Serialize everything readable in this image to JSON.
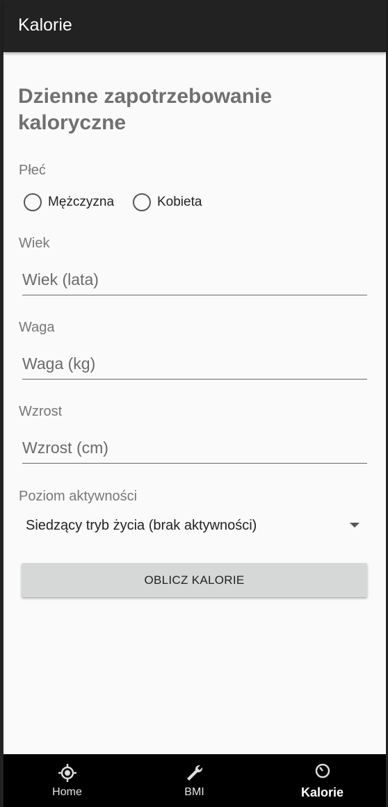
{
  "app_bar": {
    "title": "Kalorie"
  },
  "form": {
    "heading": "Dzienne zapotrzebowanie kaloryczne",
    "gender": {
      "label": "Płeć",
      "options": [
        "Mężczyzna",
        "Kobieta"
      ],
      "selected": null
    },
    "age": {
      "label": "Wiek",
      "placeholder": "Wiek (lata)",
      "value": ""
    },
    "weight": {
      "label": "Waga",
      "placeholder": "Waga (kg)",
      "value": ""
    },
    "height": {
      "label": "Wzrost",
      "placeholder": "Wzrost (cm)",
      "value": ""
    },
    "activity": {
      "label": "Poziom aktywności",
      "selected": "Siedzący tryb życia (brak aktywności)"
    },
    "submit_label": "OBLICZ KALORIE"
  },
  "bottom_nav": {
    "items": [
      {
        "label": "Home",
        "icon": "home-crosshair-icon",
        "active": false
      },
      {
        "label": "BMI",
        "icon": "wrench-icon",
        "active": false
      },
      {
        "label": "Kalorie",
        "icon": "clock-icon",
        "active": true
      }
    ]
  },
  "colors": {
    "app_bar": "#222222",
    "background": "#fafafa",
    "button": "#d6d7d7",
    "bottom_nav": "#000000"
  }
}
